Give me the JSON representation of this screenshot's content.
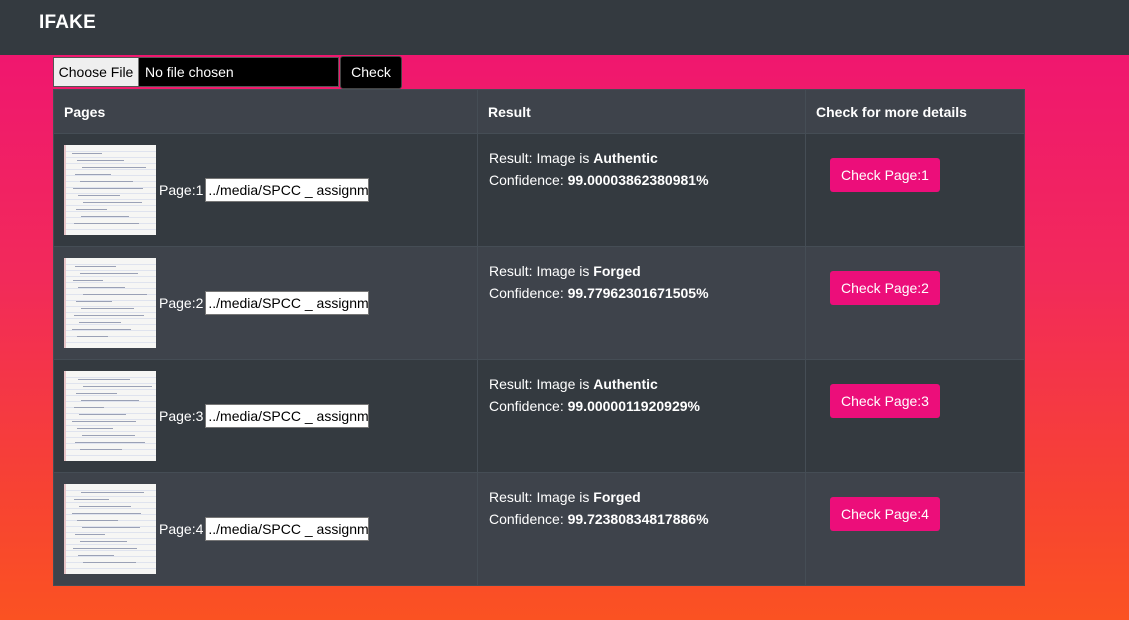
{
  "app": {
    "brand": "IFAKE"
  },
  "upload": {
    "choose_label": "Choose File",
    "status": "No file chosen",
    "check_label": "Check"
  },
  "table": {
    "headers": [
      "Pages",
      "Result",
      "Check for more details"
    ],
    "rows": [
      {
        "page_label": "Page:1",
        "path": "../media/SPCC _ assignme",
        "result_prefix": "Result: Image is ",
        "result": "Authentic",
        "confidence_prefix": "Confidence: ",
        "confidence": "99.00003862380981%",
        "button": "Check Page:1"
      },
      {
        "page_label": "Page:2",
        "path": "../media/SPCC _ assignme",
        "result_prefix": "Result: Image is ",
        "result": "Forged",
        "confidence_prefix": "Confidence: ",
        "confidence": "99.77962301671505%",
        "button": "Check Page:2"
      },
      {
        "page_label": "Page:3",
        "path": "../media/SPCC _ assignme",
        "result_prefix": "Result: Image is ",
        "result": "Authentic",
        "confidence_prefix": "Confidence: ",
        "confidence": "99.0000011920929%",
        "button": "Check Page:3"
      },
      {
        "page_label": "Page:4",
        "path": "../media/SPCC _ assignme",
        "result_prefix": "Result: Image is ",
        "result": "Forged",
        "confidence_prefix": "Confidence: ",
        "confidence": "99.72380834817886%",
        "button": "Check Page:4"
      }
    ]
  },
  "colors": {
    "navbar": "#343a40",
    "accent": "#ec0e7a",
    "gradient_top": "#ef1274",
    "gradient_bottom": "#fb5222"
  }
}
